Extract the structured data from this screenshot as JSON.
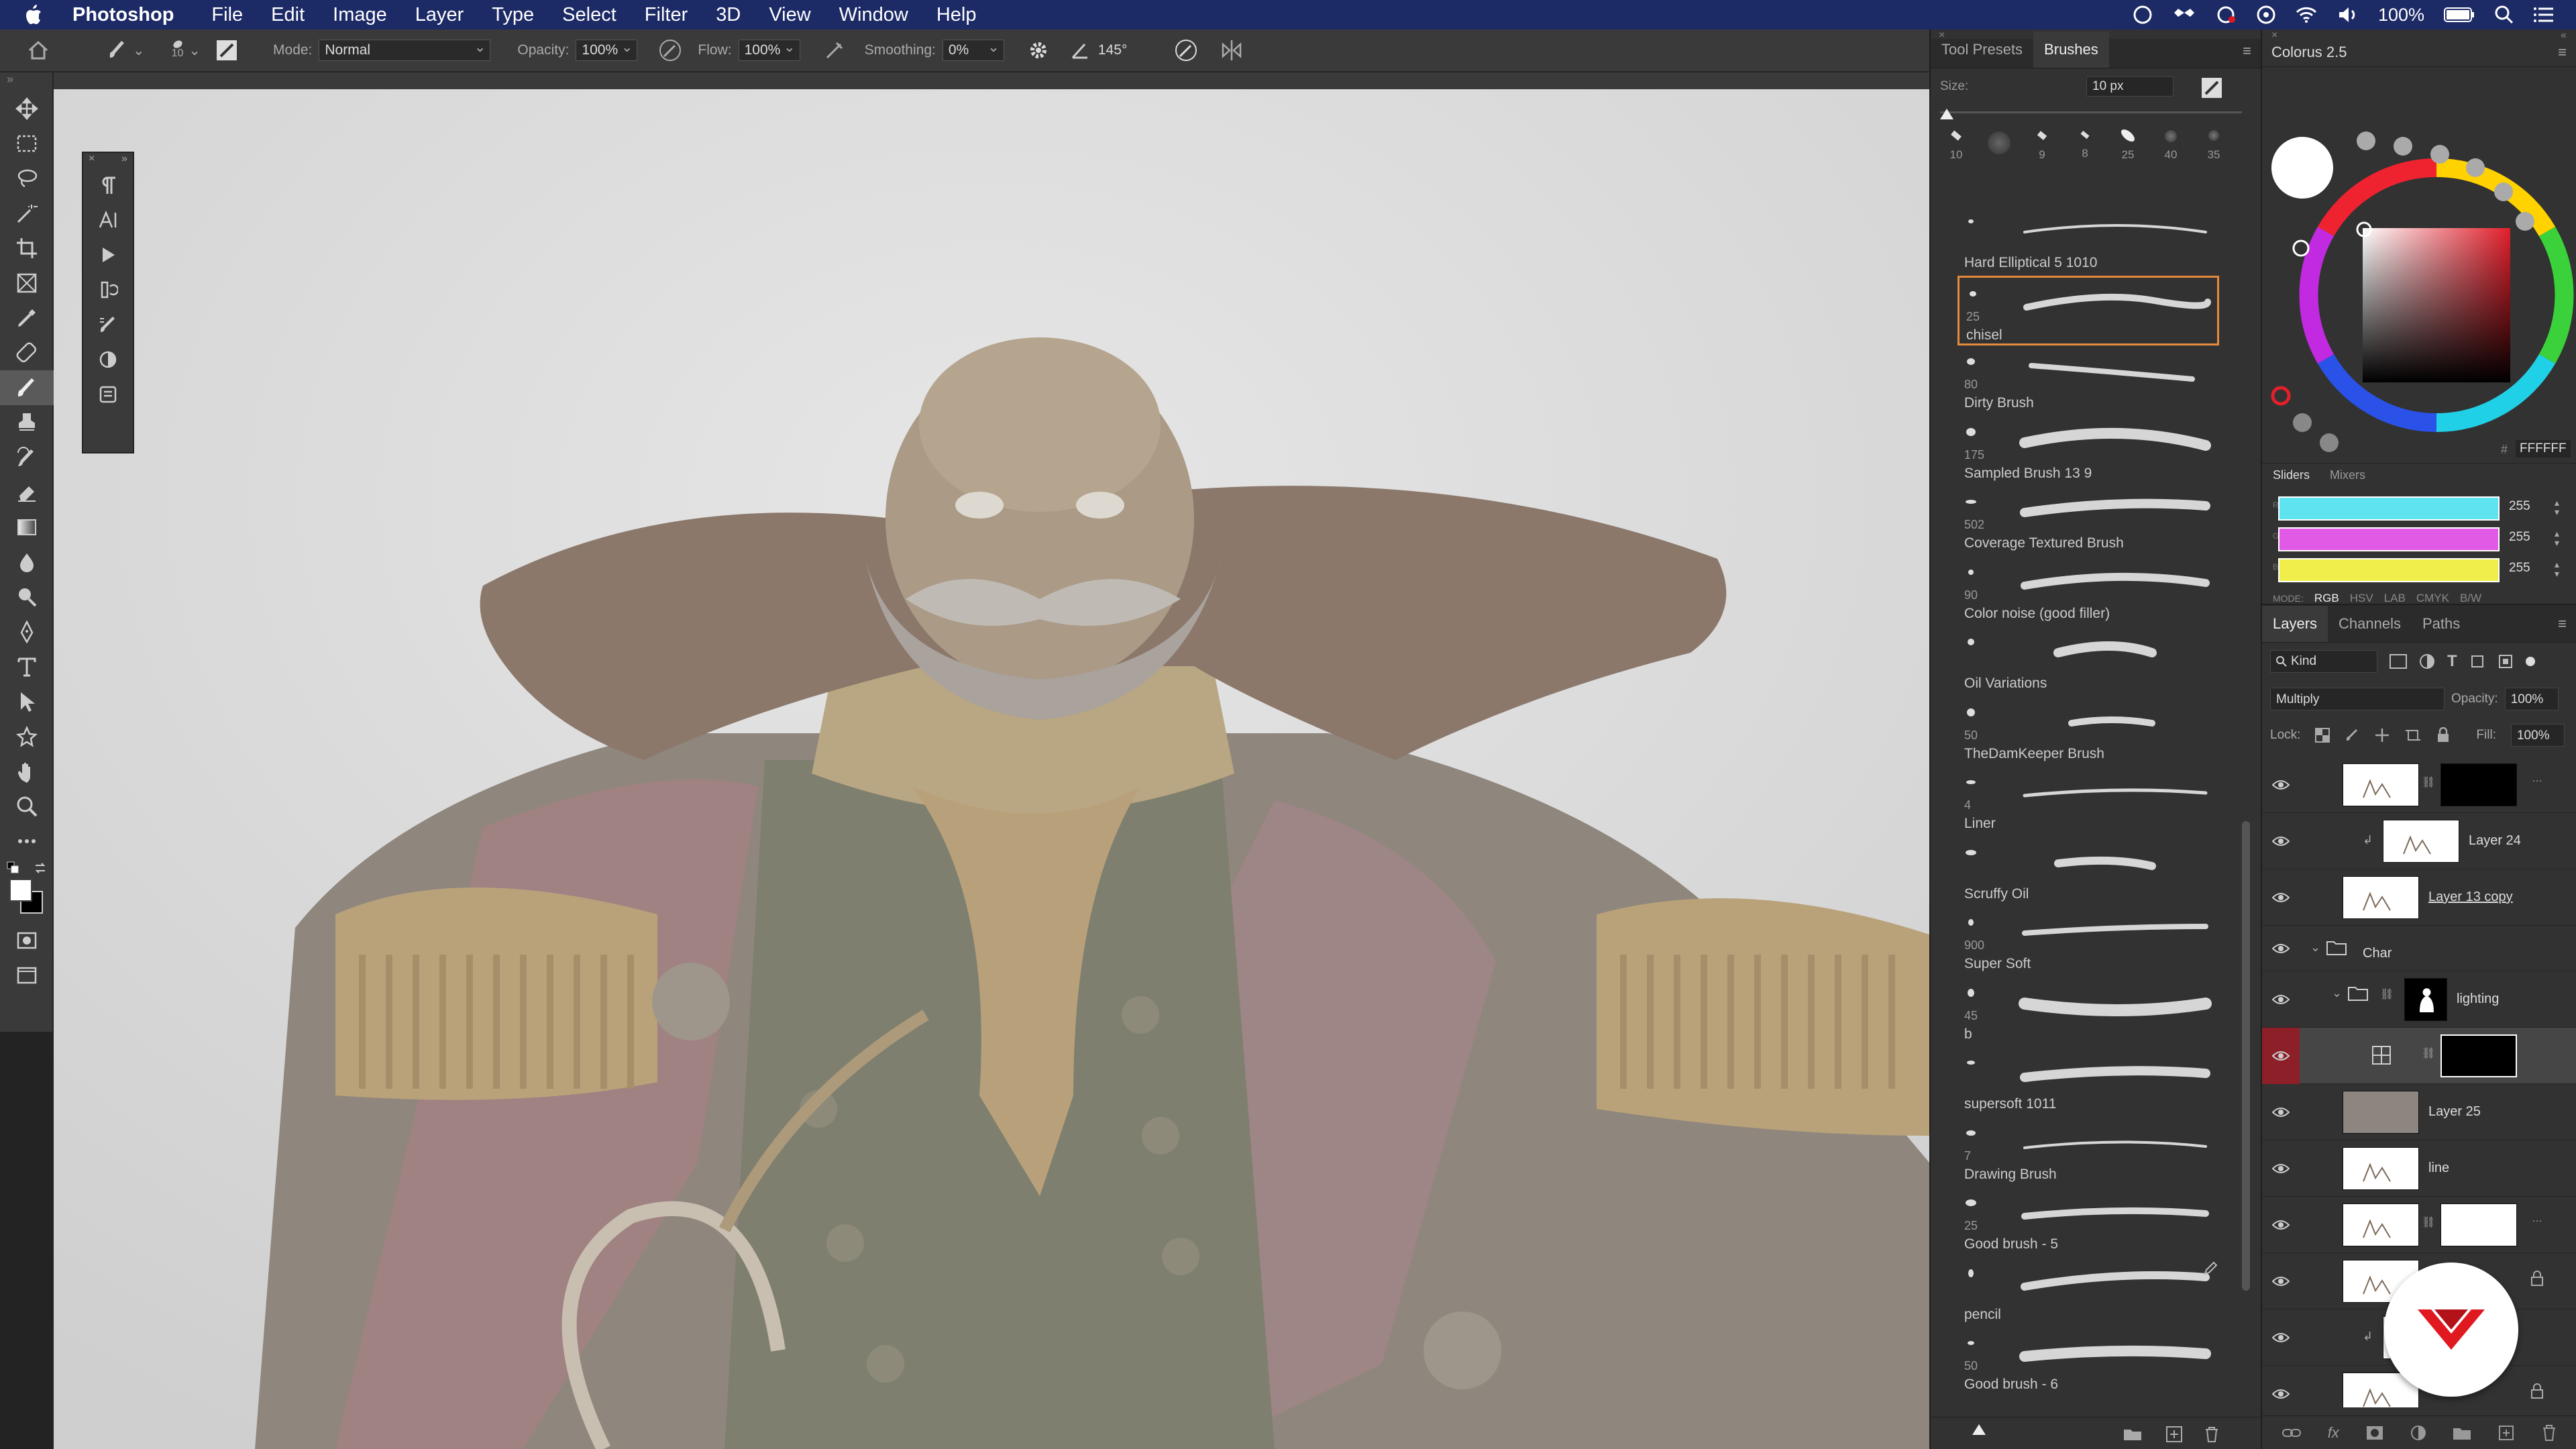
{
  "menubar": {
    "app_name": "Photoshop",
    "items": [
      "File",
      "Edit",
      "Image",
      "Layer",
      "Type",
      "Select",
      "Filter",
      "3D",
      "View",
      "Window",
      "Help"
    ],
    "battery": "100%"
  },
  "options": {
    "brush_size": "10",
    "mode_label": "Mode:",
    "mode_value": "Normal",
    "opacity_label": "Opacity:",
    "opacity_value": "100%",
    "flow_label": "Flow:",
    "flow_value": "100%",
    "smoothing_label": "Smoothing:",
    "smoothing_value": "0%",
    "angle_value": "145°"
  },
  "brushes_panel": {
    "tabs": [
      "Tool Presets",
      "Brushes"
    ],
    "active_tab": "Brushes",
    "size_label": "Size:",
    "size_value": "10 px",
    "recent_sizes": [
      "10",
      "",
      "9",
      "8",
      "25",
      "40",
      "35"
    ],
    "brushes": [
      {
        "name": "Hard Elliptical 5 1010",
        "size": ""
      },
      {
        "name": "chisel",
        "size": "25",
        "selected": true
      },
      {
        "name": "Dirty Brush",
        "size": "80"
      },
      {
        "name": "Sampled Brush 13 9",
        "size": "175"
      },
      {
        "name": "Coverage Textured Brush",
        "size": "502"
      },
      {
        "name": "Color noise (good filler)",
        "size": "90"
      },
      {
        "name": "Oil Variations",
        "size": ""
      },
      {
        "name": "TheDamKeeper Brush",
        "size": "50"
      },
      {
        "name": "Liner",
        "size": "4"
      },
      {
        "name": "Scruffy Oil",
        "size": ""
      },
      {
        "name": "Super Soft",
        "size": "900"
      },
      {
        "name": "b",
        "size": "45"
      },
      {
        "name": "supersoft 1011",
        "size": ""
      },
      {
        "name": "Drawing Brush",
        "size": "7"
      },
      {
        "name": "Good brush - 5",
        "size": "25"
      },
      {
        "name": "pencil",
        "size": ""
      },
      {
        "name": "Good brush - 6",
        "size": "50"
      }
    ]
  },
  "color_panel": {
    "title": "Colorus 2.5",
    "hex_value": "FFFFFF",
    "tabs": [
      "Sliders",
      "Mixers"
    ],
    "sliders": [
      {
        "channel": "R",
        "value": "255",
        "color": "#5fe3f0"
      },
      {
        "channel": "G",
        "value": "255",
        "color": "#e15ae6"
      },
      {
        "channel": "B",
        "value": "255",
        "color": "#f0ee4a"
      }
    ],
    "mode_label": "MODE:",
    "modes": [
      "RGB",
      "HSV",
      "LAB",
      "CMYK",
      "B/W"
    ],
    "active_mode": "RGB"
  },
  "layers_panel": {
    "tabs": [
      "Layers",
      "Channels",
      "Paths"
    ],
    "filter_label": "Kind",
    "blend_mode": "Multiply",
    "opacity_label": "Opacity:",
    "opacity_value": "100%",
    "lock_label": "Lock:",
    "fill_label": "Fill:",
    "fill_value": "100%",
    "layers": [
      {
        "name": "",
        "type": "masked"
      },
      {
        "name": "Layer 24",
        "type": "clipped"
      },
      {
        "name": "Layer 13 copy",
        "type": "normal"
      },
      {
        "name": "Char",
        "type": "group"
      },
      {
        "name": "lighting",
        "type": "group"
      },
      {
        "name": "",
        "type": "adjustment",
        "active": true
      },
      {
        "name": "Layer 25",
        "type": "fill"
      },
      {
        "name": "line",
        "type": "normal"
      },
      {
        "name": "",
        "type": "masked"
      },
      {
        "name": "",
        "type": "locked"
      },
      {
        "name": "",
        "type": "clipped"
      },
      {
        "name": "",
        "type": "locked"
      }
    ]
  },
  "colors": {
    "menubar_bg": "#1c2a66",
    "selection_orange": "#e58a3c",
    "active_layer_eye": "#8d1f28",
    "badge_red": "#e0181f"
  }
}
